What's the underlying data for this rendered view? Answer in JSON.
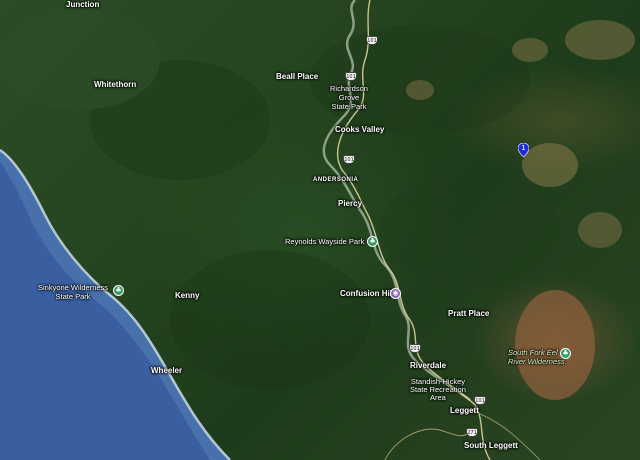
{
  "places": {
    "junction": "Junction",
    "whitethorn": "Whitethorn",
    "beall_place": "Beall Place",
    "richardson_grove": "Richardson\nGrove\nState Park",
    "cooks_valley": "Cooks Valley",
    "andersonia": "ANDERSONIA",
    "piercy": "Piercy",
    "reynolds_wayside": "Reynolds Wayside Park",
    "sinkyone": "Sinkyone Wilderness\nState Park",
    "kenny": "Kenny",
    "confusion_hill": "Confusion Hill",
    "pratt_place": "Pratt Place",
    "south_fork_eel": "South Fork Eel\nRiver Wilderness",
    "wheeler": "Wheeler",
    "riverdale": "Riverdale",
    "standish_hickey": "Standish-Hickey\nState Recreation\nArea",
    "leggett": "Leggett",
    "south_leggett": "South Leggett"
  },
  "highway": {
    "route_101": "101",
    "route_271": "271"
  },
  "marker": {
    "number": "1",
    "color": "#1a2fd6"
  },
  "colors": {
    "ocean": "#3a5fa0",
    "coast_foam": "#c9dbe0",
    "river": "#a8b6a0",
    "park_pin": "#3a9a66",
    "poi_pin": "#8a5bb8",
    "bare_land": "#8c5f3c"
  },
  "icons": {
    "park": "tree-icon",
    "attraction": "camera-icon",
    "route": "highway-shield-icon",
    "marker": "location-marker-icon"
  }
}
